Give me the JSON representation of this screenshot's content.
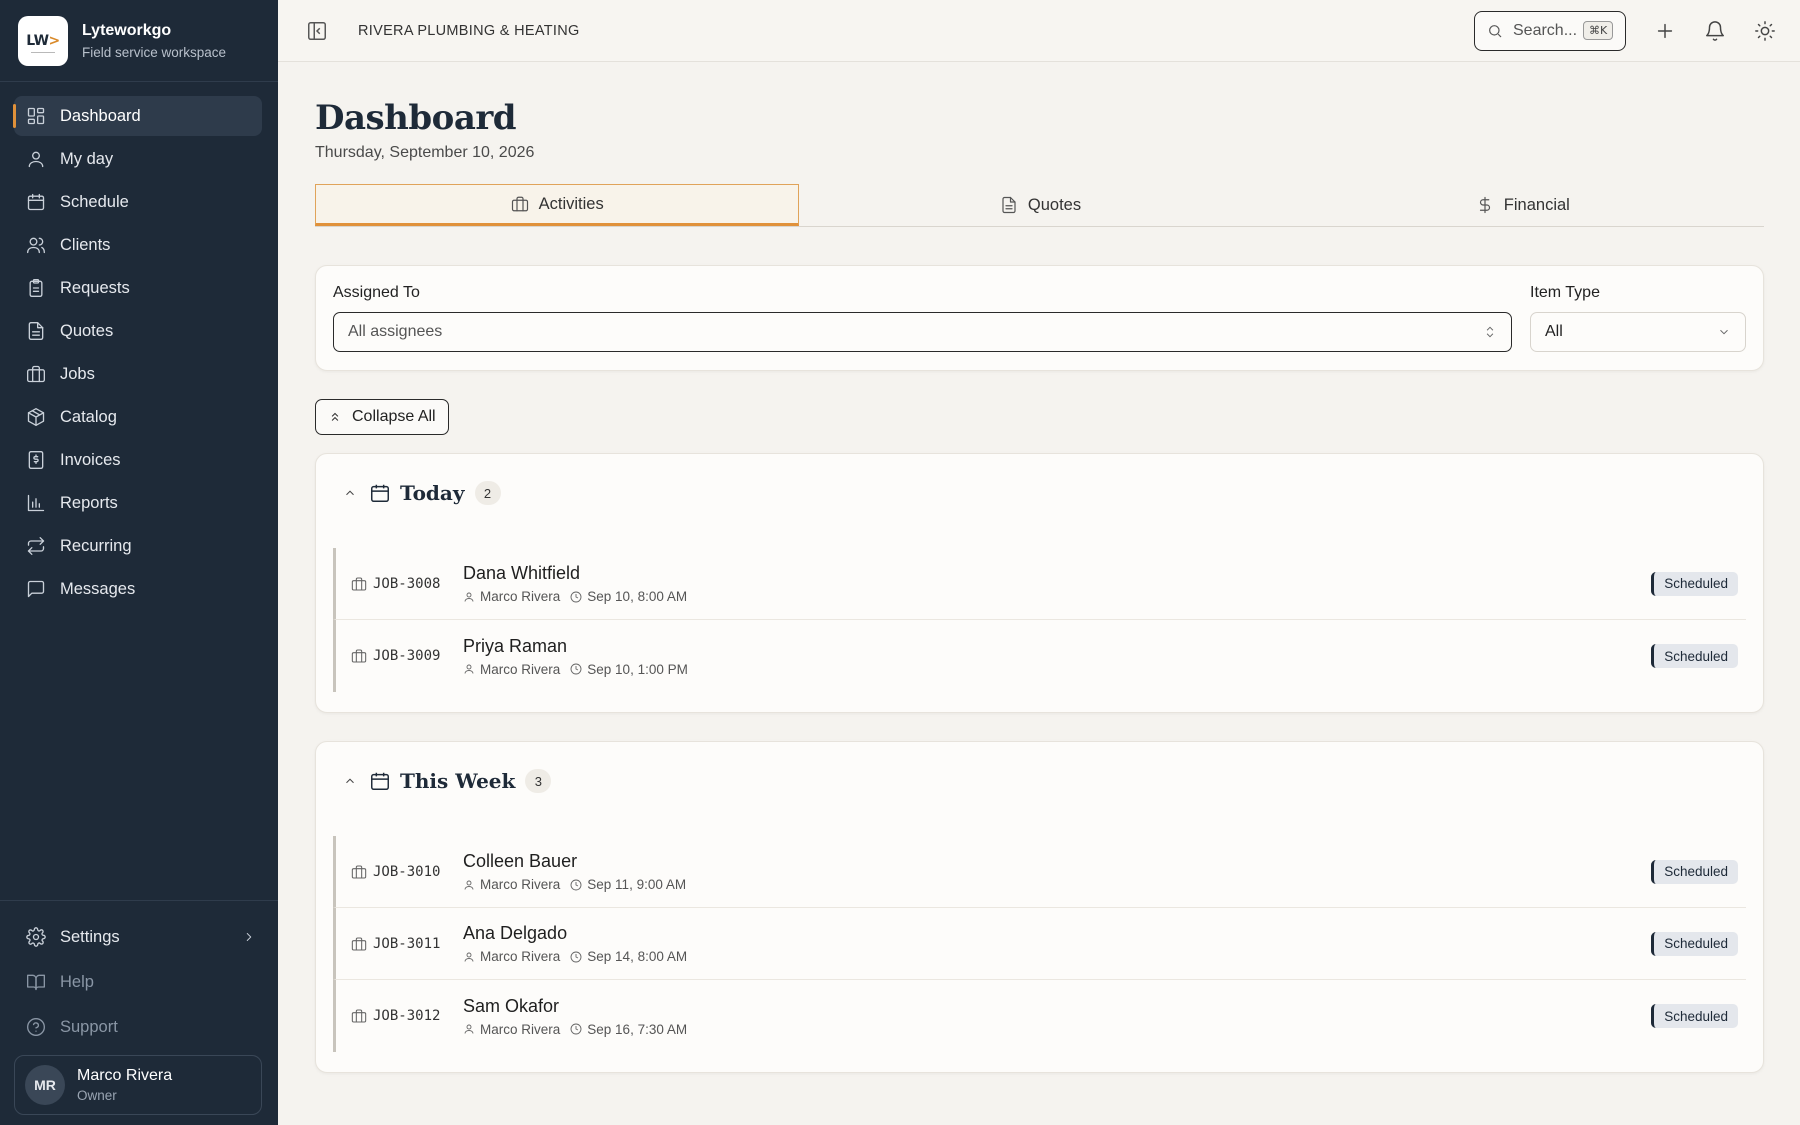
{
  "brand": {
    "logo_text": "LW",
    "logo_arrow": ">",
    "name": "Lyteworkgo",
    "tagline": "Field service workspace"
  },
  "sidebar": {
    "items": [
      {
        "label": "Dashboard",
        "icon": "dashboard-icon",
        "active": true
      },
      {
        "label": "My day",
        "icon": "user-icon"
      },
      {
        "label": "Schedule",
        "icon": "calendar-icon"
      },
      {
        "label": "Clients",
        "icon": "users-icon"
      },
      {
        "label": "Requests",
        "icon": "clipboard-icon"
      },
      {
        "label": "Quotes",
        "icon": "document-icon"
      },
      {
        "label": "Jobs",
        "icon": "briefcase-icon"
      },
      {
        "label": "Catalog",
        "icon": "package-icon"
      },
      {
        "label": "Invoices",
        "icon": "invoice-icon"
      },
      {
        "label": "Reports",
        "icon": "chart-icon"
      },
      {
        "label": "Recurring",
        "icon": "repeat-icon"
      },
      {
        "label": "Messages",
        "icon": "message-icon"
      }
    ],
    "settings_label": "Settings",
    "help_label": "Help",
    "support_label": "Support",
    "user": {
      "initials": "MR",
      "name": "Marco Rivera",
      "role": "Owner"
    }
  },
  "topbar": {
    "company": "RIVERA PLUMBING & HEATING",
    "search_placeholder": "Search...",
    "search_shortcut": "⌘K"
  },
  "page": {
    "title": "Dashboard",
    "date": "Thursday, September 10, 2026"
  },
  "tabs": [
    {
      "label": "Activities",
      "icon": "briefcase-icon",
      "active": true
    },
    {
      "label": "Quotes",
      "icon": "document-icon"
    },
    {
      "label": "Financial",
      "icon": "dollar-icon"
    }
  ],
  "filters": {
    "assigned_label": "Assigned To",
    "assigned_value": "All assignees",
    "type_label": "Item Type",
    "type_value": "All"
  },
  "collapse_label": "Collapse All",
  "groups": [
    {
      "title": "Today",
      "count": "2",
      "rows": [
        {
          "id": "JOB-3008",
          "name": "Dana Whitfield",
          "assignee": "Marco Rivera",
          "time": "Sep 10, 8:00 AM",
          "status": "Scheduled"
        },
        {
          "id": "JOB-3009",
          "name": "Priya Raman",
          "assignee": "Marco Rivera",
          "time": "Sep 10, 1:00 PM",
          "status": "Scheduled"
        }
      ]
    },
    {
      "title": "This Week",
      "count": "3",
      "rows": [
        {
          "id": "JOB-3010",
          "name": "Colleen Bauer",
          "assignee": "Marco Rivera",
          "time": "Sep 11, 9:00 AM",
          "status": "Scheduled"
        },
        {
          "id": "JOB-3011",
          "name": "Ana Delgado",
          "assignee": "Marco Rivera",
          "time": "Sep 14, 8:00 AM",
          "status": "Scheduled"
        },
        {
          "id": "JOB-3012",
          "name": "Sam Okafor",
          "assignee": "Marco Rivera",
          "time": "Sep 16, 7:30 AM",
          "status": "Scheduled"
        }
      ]
    }
  ],
  "colors": {
    "sidebar_bg": "#1e2a38",
    "accent": "#e0913a",
    "page_bg": "#f5f3ef"
  }
}
